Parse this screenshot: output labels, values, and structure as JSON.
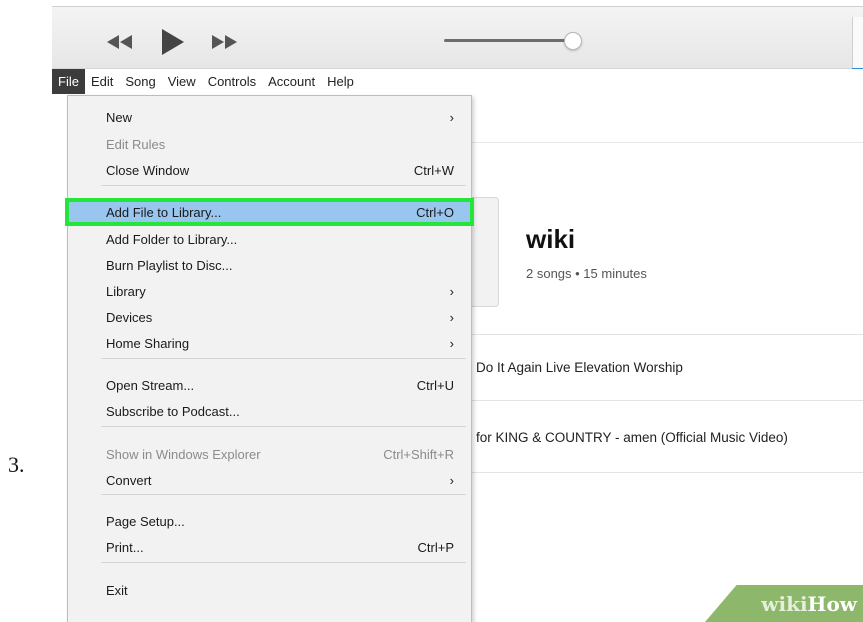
{
  "step_number": "3.",
  "menubar": [
    "File",
    "Edit",
    "Song",
    "View",
    "Controls",
    "Account",
    "Help"
  ],
  "file_menu": {
    "items": [
      {
        "label": "New",
        "shortcut": "",
        "submenu": true,
        "disabled": false,
        "highlight": false
      },
      {
        "label": "Edit Rules",
        "shortcut": "",
        "submenu": false,
        "disabled": true,
        "highlight": false
      },
      {
        "label": "Close Window",
        "shortcut": "Ctrl+W",
        "submenu": false,
        "disabled": false,
        "highlight": false
      },
      {
        "label": "Add File to Library...",
        "shortcut": "Ctrl+O",
        "submenu": false,
        "disabled": false,
        "highlight": true
      },
      {
        "label": "Add Folder to Library...",
        "shortcut": "",
        "submenu": false,
        "disabled": false,
        "highlight": false
      },
      {
        "label": "Burn Playlist to Disc...",
        "shortcut": "",
        "submenu": false,
        "disabled": false,
        "highlight": false
      },
      {
        "label": "Library",
        "shortcut": "",
        "submenu": true,
        "disabled": false,
        "highlight": false
      },
      {
        "label": "Devices",
        "shortcut": "",
        "submenu": true,
        "disabled": false,
        "highlight": false
      },
      {
        "label": "Home Sharing",
        "shortcut": "",
        "submenu": true,
        "disabled": false,
        "highlight": false
      },
      {
        "label": "Open Stream...",
        "shortcut": "Ctrl+U",
        "submenu": false,
        "disabled": false,
        "highlight": false
      },
      {
        "label": "Subscribe to Podcast...",
        "shortcut": "",
        "submenu": false,
        "disabled": false,
        "highlight": false
      },
      {
        "label": "Show in Windows Explorer",
        "shortcut": "Ctrl+Shift+R",
        "submenu": false,
        "disabled": true,
        "highlight": false
      },
      {
        "label": "Convert",
        "shortcut": "",
        "submenu": true,
        "disabled": false,
        "highlight": false
      },
      {
        "label": "Page Setup...",
        "shortcut": "",
        "submenu": false,
        "disabled": false,
        "highlight": false
      },
      {
        "label": "Print...",
        "shortcut": "Ctrl+P",
        "submenu": false,
        "disabled": false,
        "highlight": false
      },
      {
        "label": "Exit",
        "shortcut": "",
        "submenu": false,
        "disabled": false,
        "highlight": false
      }
    ]
  },
  "playlist": {
    "title": "wiki",
    "meta": "2 songs • 15 minutes",
    "songs": [
      "Do It Again Live Elevation Worship",
      "for KING & COUNTRY - amen (Official Music Video)"
    ]
  },
  "watermark": {
    "part1": "wiki",
    "part2": "How"
  },
  "colors": {
    "highlight_fill": "#99c6ef",
    "highlight_outline": "#24e53a",
    "menu_bg": "#f2f2f2"
  },
  "icons": [
    "rewind-icon",
    "play-icon",
    "fast-forward-icon",
    "submenu-arrow-icon"
  ]
}
